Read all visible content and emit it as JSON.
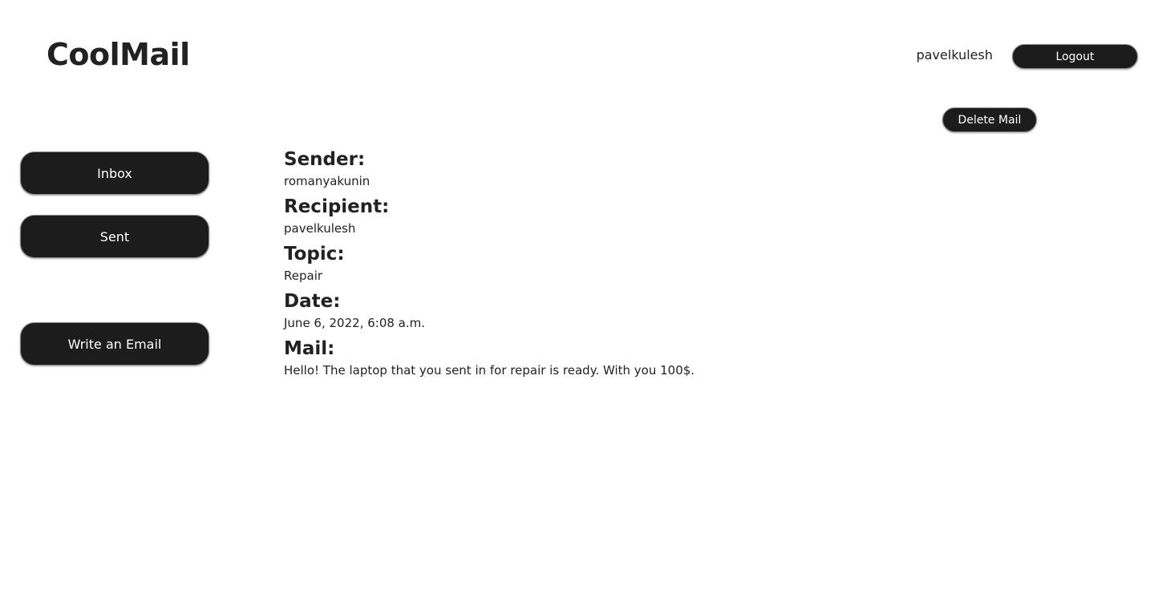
{
  "header": {
    "logo": "CoolMail",
    "username": "pavelkulesh",
    "logout_label": "Logout"
  },
  "actions": {
    "delete_label": "Delete Mail"
  },
  "sidebar": {
    "items": [
      {
        "label": "Inbox"
      },
      {
        "label": "Sent"
      },
      {
        "label": "Write an Email"
      }
    ]
  },
  "mail": {
    "sender_label": "Sender:",
    "sender": "romanyakunin",
    "recipient_label": "Recipient:",
    "recipient": "pavelkulesh",
    "topic_label": "Topic:",
    "topic": "Repair",
    "date_label": "Date:",
    "date": "June 6, 2022, 6:08 a.m.",
    "body_label": "Mail:",
    "body": "Hello! The laptop that you sent in for repair is ready. With you 100$."
  },
  "colors": {
    "button_bg": "#1c1c1c",
    "text": "#222222",
    "background": "#ffffff"
  }
}
